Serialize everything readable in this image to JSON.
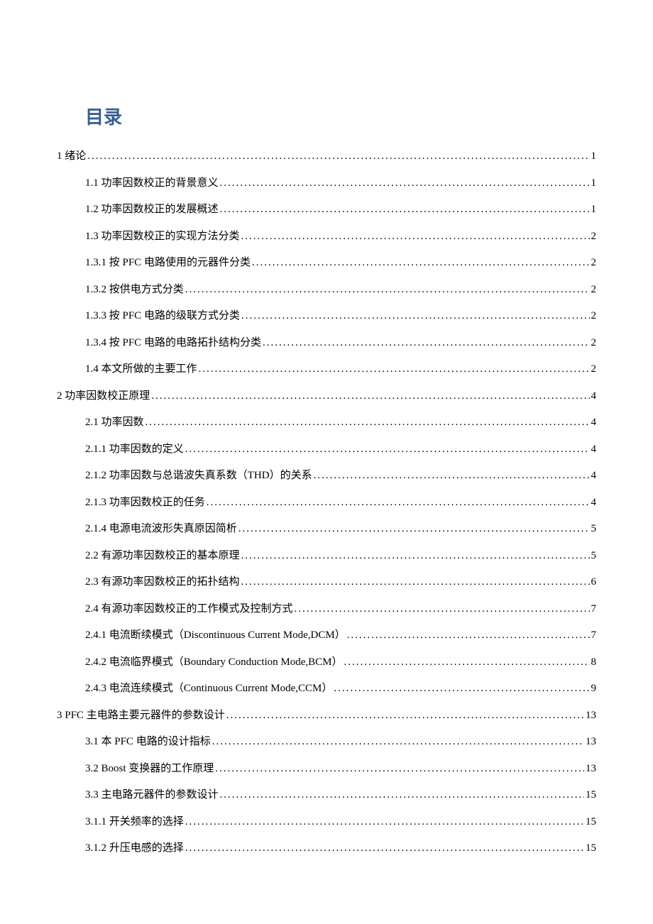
{
  "title": "目录",
  "toc": [
    {
      "level": 0,
      "text": "1  绪论",
      "page": "1"
    },
    {
      "level": 1,
      "text": "1.1  功率因数校正的背景意义",
      "page": "1"
    },
    {
      "level": 1,
      "text": "1.2  功率因数校正的发展概述",
      "page": "1"
    },
    {
      "level": 1,
      "text": "1.3 功率因数校正的实现方法分类",
      "page": "2"
    },
    {
      "level": 1,
      "text": "1.3.1 按 PFC 电路使用的元器件分类",
      "page": "2"
    },
    {
      "level": 1,
      "text": "1.3.2  按供电方式分类",
      "page": "2"
    },
    {
      "level": 1,
      "text": "1.3.3  按 PFC 电路的级联方式分类",
      "page": "2"
    },
    {
      "level": 1,
      "text": "1.3.4  按 PFC 电路的电路拓扑结构分类",
      "page": "2"
    },
    {
      "level": 1,
      "text": "1.4  本文所做的主要工作",
      "page": "2"
    },
    {
      "level": 0,
      "text": "2  功率因数校正原理",
      "page": "4"
    },
    {
      "level": 1,
      "text": "2.1  功率因数",
      "page": "4"
    },
    {
      "level": 1,
      "text": "2.1.1  功率因数的定义",
      "page": "4"
    },
    {
      "level": 1,
      "text": "2.1.2  功率因数与总谐波失真系数（THD）的关系",
      "page": "4"
    },
    {
      "level": 1,
      "text": "2.1.3 功率因数校正的任务",
      "page": "4"
    },
    {
      "level": 1,
      "text": "2.1.4 电源电流波形失真原因简析",
      "page": "5"
    },
    {
      "level": 1,
      "text": "2.2  有源功率因数校正的基本原理",
      "page": "5"
    },
    {
      "level": 1,
      "text": "2.3  有源功率因数校正的拓扑结构",
      "page": "6"
    },
    {
      "level": 1,
      "text": "2.4  有源功率因数校正的工作模式及控制方式",
      "page": "7"
    },
    {
      "level": 1,
      "text": "2.4.1 电流断续模式（Discontinuous Current Mode,DCM）",
      "page": "7"
    },
    {
      "level": 1,
      "text": "2.4.2 电流临界模式（Boundary Conduction Mode,BCM）",
      "page": "8"
    },
    {
      "level": 1,
      "text": "2.4.3 电流连续模式（Continuous Current Mode,CCM）",
      "page": "9"
    },
    {
      "level": 0,
      "text": "3 PFC 主电路主要元器件的参数设计",
      "page": "13"
    },
    {
      "level": 1,
      "text": "3.1 本 PFC 电路的设计指标",
      "page": "13"
    },
    {
      "level": 1,
      "text": "3.2 Boost 变换器的工作原理",
      "page": "13"
    },
    {
      "level": 1,
      "text": "3.3 主电路元器件的参数设计",
      "page": "15"
    },
    {
      "level": 1,
      "text": "3.1.1 开关频率的选择",
      "page": "15"
    },
    {
      "level": 1,
      "text": "3.1.2 升压电感的选择",
      "page": "15"
    }
  ]
}
